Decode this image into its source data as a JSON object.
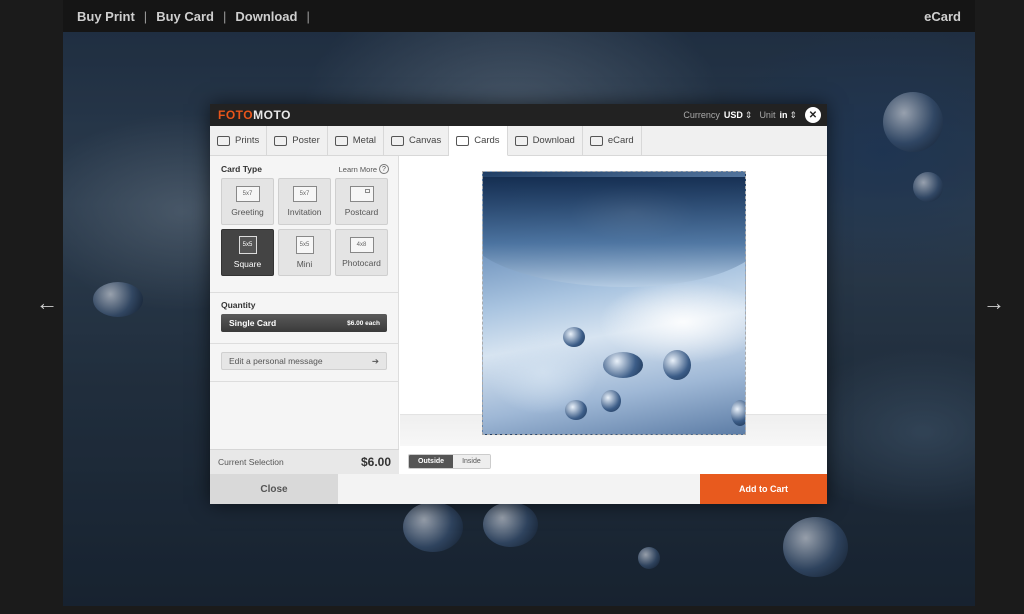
{
  "topnav": {
    "links": [
      "Buy Print",
      "Buy Card",
      "Download"
    ],
    "separator": "|",
    "ecard": "eCard"
  },
  "arrows": {
    "prev": "←",
    "next": "→"
  },
  "modal": {
    "logo_a": "FOTO",
    "logo_b": "MOTO",
    "currency_label": "Currency",
    "currency_value": "USD",
    "unit_label": "Unit",
    "unit_value": "in",
    "updown": "⇕",
    "close_glyph": "✕",
    "tabs": [
      {
        "label": "Prints",
        "icon": "prints-icon"
      },
      {
        "label": "Poster",
        "icon": "poster-icon"
      },
      {
        "label": "Metal",
        "icon": "metal-icon"
      },
      {
        "label": "Canvas",
        "icon": "canvas-icon"
      },
      {
        "label": "Cards",
        "icon": "cards-icon"
      },
      {
        "label": "Download",
        "icon": "download-icon"
      },
      {
        "label": "eCard",
        "icon": "ecard-icon"
      }
    ],
    "active_tab": "Cards",
    "card_type": {
      "title": "Card Type",
      "learn_more": "Learn More",
      "help": "?",
      "options": [
        {
          "size": "5x7",
          "label": "Greeting"
        },
        {
          "size": "5x7",
          "label": "Invitation"
        },
        {
          "size": "",
          "label": "Postcard"
        },
        {
          "size": "5x5",
          "label": "Square"
        },
        {
          "size": "5x5",
          "label": "Mini"
        },
        {
          "size": "4x8",
          "label": "Photocard"
        }
      ],
      "selected": "Square"
    },
    "quantity": {
      "title": "Quantity",
      "value": "Single Card",
      "price": "$6.00 each"
    },
    "message": {
      "label": "Edit a personal message",
      "arrow": "➔"
    },
    "current": {
      "label": "Current Selection",
      "price": "$6.00"
    },
    "view_toggle": {
      "outside": "Outside",
      "inside": "Inside",
      "selected": "Outside"
    },
    "footer": {
      "close": "Close",
      "add": "Add to Cart"
    }
  },
  "colors": {
    "accent": "#e85a1e",
    "logo_accent": "#e9551a",
    "selected_option": "#444444"
  }
}
